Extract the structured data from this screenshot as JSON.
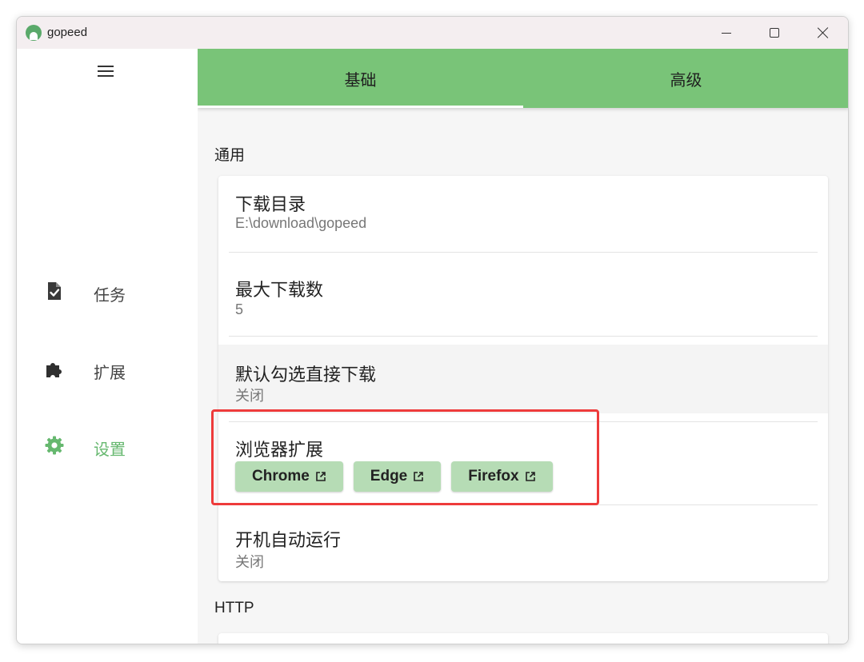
{
  "window": {
    "title": "gopeed"
  },
  "sidebar": {
    "items": [
      {
        "label": "任务",
        "icon": "task-file-check-icon"
      },
      {
        "label": "扩展",
        "icon": "puzzle-icon"
      },
      {
        "label": "设置",
        "icon": "gear-icon",
        "active": true
      }
    ]
  },
  "tabs": [
    {
      "label": "基础",
      "active": true
    },
    {
      "label": "高级",
      "active": false
    }
  ],
  "sections": {
    "general": {
      "title": "通用",
      "rows": [
        {
          "title": "下载目录",
          "value": "E:\\download\\gopeed"
        },
        {
          "title": "最大下载数",
          "value": "5"
        },
        {
          "title": "默认勾选直接下载",
          "value": "关闭"
        },
        {
          "title": "浏览器扩展",
          "buttons": [
            "Chrome",
            "Edge",
            "Firefox"
          ]
        },
        {
          "title": "开机自动运行",
          "value": "关闭"
        }
      ]
    },
    "http": {
      "title": "HTTP"
    }
  },
  "colors": {
    "accent": "#79c478",
    "active_nav": "#66b86f",
    "button_bg": "#b6dcb5",
    "highlight": "#ee3b3b"
  }
}
